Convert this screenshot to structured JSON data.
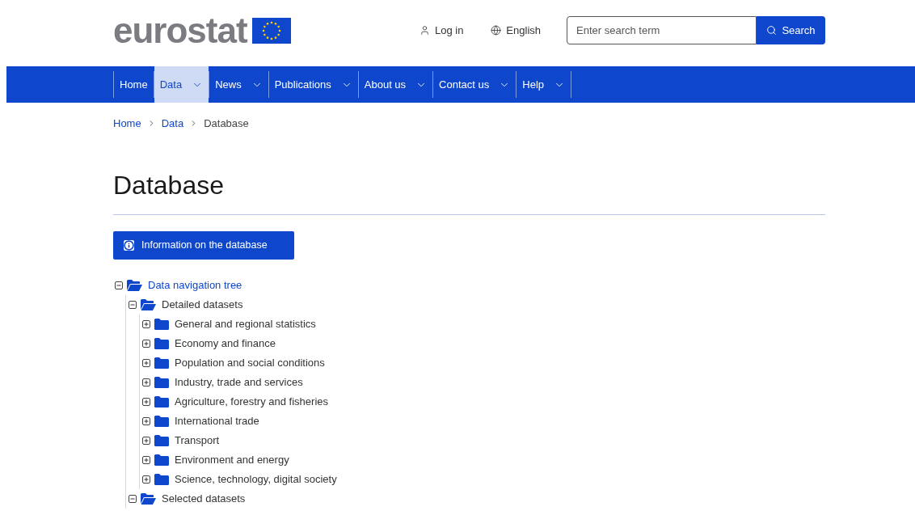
{
  "header": {
    "logo_text": "eurostat",
    "login": "Log in",
    "language": "English",
    "search": {
      "placeholder": "Enter search term",
      "button": "Search"
    }
  },
  "nav": [
    {
      "label": "Home",
      "selected": false,
      "dropdown": false
    },
    {
      "label": "Data",
      "selected": true,
      "dropdown": true
    },
    {
      "label": "News",
      "selected": false,
      "dropdown": true
    },
    {
      "label": "Publications",
      "selected": false,
      "dropdown": true
    },
    {
      "label": "About us",
      "selected": false,
      "dropdown": true
    },
    {
      "label": "Contact us",
      "selected": false,
      "dropdown": true
    },
    {
      "label": "Help",
      "selected": false,
      "dropdown": true
    }
  ],
  "breadcrumb": [
    {
      "label": "Home",
      "link": true
    },
    {
      "label": "Data",
      "link": true
    },
    {
      "label": "Database",
      "link": false
    }
  ],
  "title": "Database",
  "info_button": "Information on the database",
  "tree": [
    {
      "label": "Data navigation tree",
      "link": true,
      "expanded": true,
      "children": [
        {
          "label": "Detailed datasets",
          "link": false,
          "expanded": true,
          "children": [
            {
              "label": "General and regional statistics",
              "link": false,
              "expanded": false
            },
            {
              "label": "Economy and finance",
              "link": false,
              "expanded": false
            },
            {
              "label": "Population and social conditions",
              "link": false,
              "expanded": false
            },
            {
              "label": "Industry, trade and services",
              "link": false,
              "expanded": false
            },
            {
              "label": "Agriculture, forestry and fisheries",
              "link": false,
              "expanded": false
            },
            {
              "label": "International trade",
              "link": false,
              "expanded": false
            },
            {
              "label": "Transport",
              "link": false,
              "expanded": false
            },
            {
              "label": "Environment and energy",
              "link": false,
              "expanded": false
            },
            {
              "label": "Science, technology, digital society",
              "link": false,
              "expanded": false
            }
          ]
        },
        {
          "label": "Selected datasets",
          "link": false,
          "expanded": true
        }
      ]
    }
  ]
}
